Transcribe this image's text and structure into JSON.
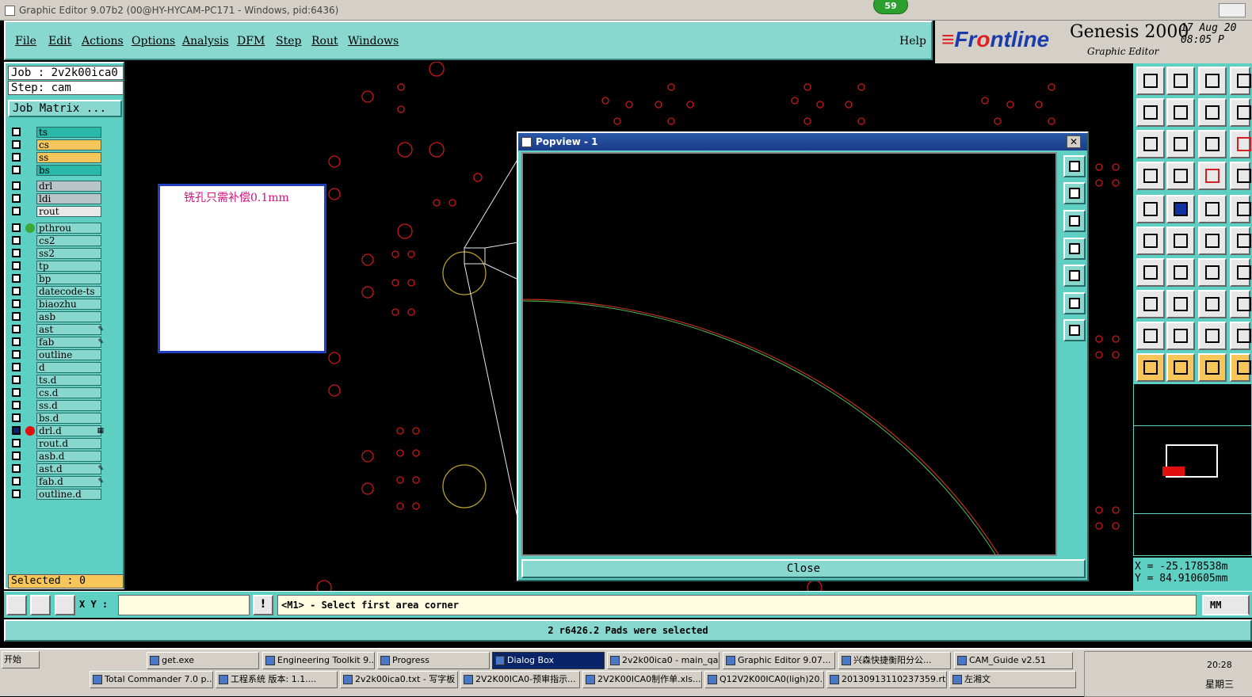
{
  "window": {
    "title": "Graphic Editor 9.07b2 (00@HY-HYCAM-PC171 - Windows, pid:6436)",
    "badge": "59"
  },
  "menu": {
    "items": [
      "File",
      "Edit",
      "Actions",
      "Options",
      "Analysis",
      "DFM",
      "Step",
      "Rout",
      "Windows"
    ],
    "help": "Help"
  },
  "brand": {
    "logo_a": "Fr",
    "logo_b": "o",
    "logo_c": "ntline",
    "product": "Genesis 2000",
    "subtitle": "Graphic Editor",
    "date": "17 Aug 20",
    "time": "08:05 P"
  },
  "job": {
    "job_line": "Job : 2v2k00ica0",
    "step_line": "Step: cam",
    "matrix_button": "Job Matrix ..."
  },
  "layers": [
    {
      "name": "ts",
      "color": "#2ab8a8"
    },
    {
      "name": "cs",
      "color": "#f6c65a"
    },
    {
      "name": "ss",
      "color": "#f6c65a"
    },
    {
      "name": "bs",
      "color": "#2ab8a8"
    },
    {
      "name": "drl",
      "color": "#b8c4c8"
    },
    {
      "name": "ldi",
      "color": "#b8c4c8"
    },
    {
      "name": "rout",
      "color": "#e8e8e8"
    },
    {
      "name": "pthrou",
      "color": "#88d8d0",
      "dot": "#3aa83a"
    },
    {
      "name": "cs2",
      "color": "#88d8d0"
    },
    {
      "name": "ss2",
      "color": "#88d8d0"
    },
    {
      "name": "tp",
      "color": "#88d8d0"
    },
    {
      "name": "bp",
      "color": "#88d8d0"
    },
    {
      "name": "datecode-ts",
      "color": "#88d8d0"
    },
    {
      "name": "biaozhu",
      "color": "#88d8d0"
    },
    {
      "name": "asb",
      "color": "#88d8d0"
    },
    {
      "name": "ast",
      "color": "#88d8d0",
      "mark": "✎"
    },
    {
      "name": "fab",
      "color": "#88d8d0",
      "mark": "✎"
    },
    {
      "name": "outline",
      "color": "#88d8d0"
    },
    {
      "name": "d",
      "color": "#88d8d0"
    },
    {
      "name": "ts.d",
      "color": "#88d8d0"
    },
    {
      "name": "cs.d",
      "color": "#88d8d0"
    },
    {
      "name": "ss.d",
      "color": "#88d8d0"
    },
    {
      "name": "bs.d",
      "color": "#88d8d0"
    },
    {
      "name": "drl.d",
      "color": "#88d8d0",
      "dot": "#e01010",
      "checked": true,
      "mark": "▦"
    },
    {
      "name": "rout.d",
      "color": "#88d8d0"
    },
    {
      "name": "asb.d",
      "color": "#88d8d0"
    },
    {
      "name": "ast.d",
      "color": "#88d8d0",
      "mark": "✎"
    },
    {
      "name": "fab.d",
      "color": "#88d8d0",
      "mark": "✎"
    },
    {
      "name": "outline.d",
      "color": "#88d8d0"
    }
  ],
  "selected": "Selected : 0",
  "note": {
    "text": "铣孔只需补偿0.1mm"
  },
  "popview": {
    "title": "Popview - 1",
    "close": "Close",
    "close_x": "✕"
  },
  "coords": {
    "x": "X = -25.178538m",
    "y": "Y = 84.910605mm"
  },
  "cmd": {
    "xy_label": "X Y :",
    "xy_value": "",
    "prompt": "<M1> - Select first area corner",
    "unit": "MM"
  },
  "status": "2 r6426.2 Pads were selected",
  "taskbar": {
    "start": "开始",
    "row1": [
      "get.exe",
      "Engineering Toolkit 9....",
      "Progress",
      "Dialog Box",
      "2v2k00ica0 - main_qa",
      "Graphic Editor 9.07...",
      "兴森快捷衡阳分公...",
      "CAM_Guide v2.51"
    ],
    "row2": [
      "Total Commander 7.0 p...",
      "工程系统  版本: 1.1....",
      "2v2k00ica0.txt - 写字板",
      "2V2K00ICA0-预审指示...",
      "2V2K00ICA0制作单.xls...",
      "Q12V2K00ICA0(ligh)20...",
      "20130913110237359.rt...",
      "左湘文"
    ],
    "active": "Dialog Box",
    "clock": "20:28",
    "weekday": "星期三"
  }
}
